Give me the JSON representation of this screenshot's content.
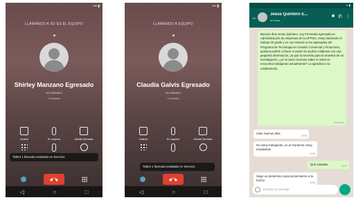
{
  "call1": {
    "status_left": "",
    "status_right": "",
    "call_status": "LLAMANDO A SU ES EL EQUIPO",
    "caller_name": "Shirley Manzano Egresado",
    "caller_number": "310 5564523",
    "caller_location": "Colombia",
    "controls_top": [
      "Grabar",
      "En espera",
      "Añadir llamada"
    ],
    "controls_bottom": [
      "",
      "Silencio",
      "Contactos"
    ],
    "toast": "Tablet 1 llamada instalada en Servicio"
  },
  "call2": {
    "call_status": "LLAMANDO A EQUIPO",
    "caller_name": "Claudia Galvis Egresado",
    "caller_number": "310 5564521",
    "caller_location": "Colombia",
    "controls_top": [
      "Grabar",
      "En espera",
      "Añadir llamada"
    ],
    "controls_bottom": [
      "",
      "Silencio",
      "Contactos"
    ],
    "toast": "Tablet 1 llamada instalada en Servicio"
  },
  "chat": {
    "contact_name": "Jesus Quintero E...",
    "contact_status": "en línea",
    "messages": [
      {
        "dir": "out",
        "text": "Buenos días Jesus Quintero, soy Fernanda egresada en Administración de empresas de la UFPSO, estoy haciendo mi trabajo de grado y es con relación a los egresados del Programa de Tecnología en Gestión Comercial y Financiera, quisiera pedirle el favor si usted me podría colaborar con una pequeña información, ya que la necesito para la muestra de mi investigación, ¿en lo tanto necesito saber si usted se encuentra trabajando actualmente? La agradezco su colaboración.",
        "time": "10:22 a.m."
      },
      {
        "dir": "in",
        "text": "Hola, buenos días",
        "time": "10:25"
      },
      {
        "dir": "in",
        "text": "No estoy trabajando, en el momento estoy estudiando",
        "time": "10:26"
      },
      {
        "dir": "out",
        "text": "Que estudias",
        "time": "10:27"
      },
      {
        "dir": "in",
        "text": "Hago un preterésico para presentarme a la fuerza",
        "time": "10:30"
      }
    ],
    "input_placeholder": "Escribir un mensaje"
  }
}
